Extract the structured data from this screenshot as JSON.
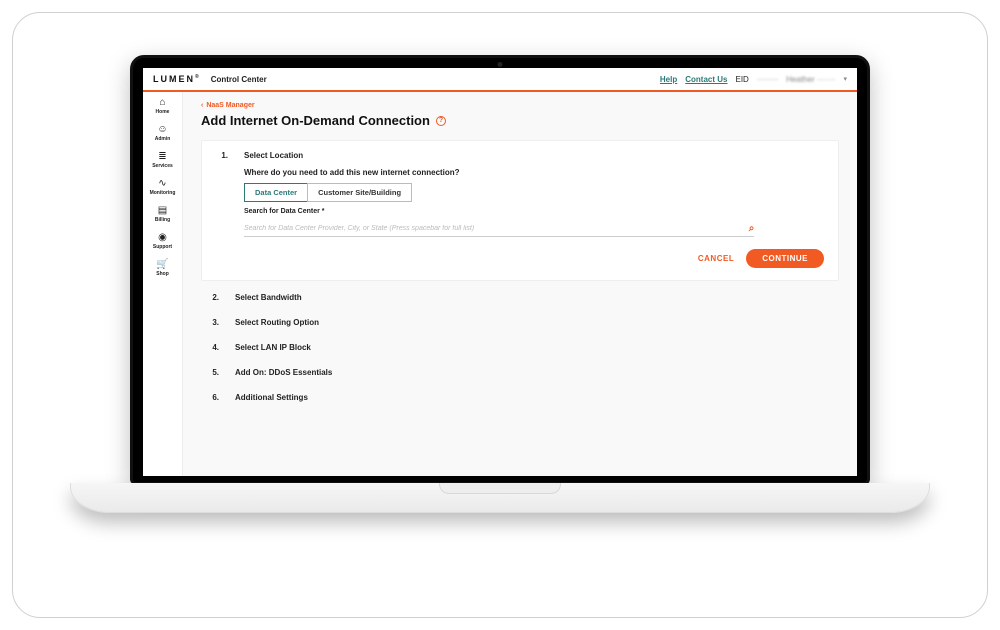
{
  "brand": "LUMEN",
  "app_name": "Control Center",
  "header": {
    "help": "Help",
    "contact": "Contact Us",
    "eid_label": "EID",
    "eid_value": "········",
    "username": "Heather ·······"
  },
  "sidebar": [
    {
      "icon": "⌂",
      "label": "Home",
      "name": "sidebar-item-home"
    },
    {
      "icon": "☺",
      "label": "Admin",
      "name": "sidebar-item-admin"
    },
    {
      "icon": "≣",
      "label": "Services",
      "name": "sidebar-item-services"
    },
    {
      "icon": "∿",
      "label": "Monitoring",
      "name": "sidebar-item-monitoring"
    },
    {
      "icon": "▤",
      "label": "Billing",
      "name": "sidebar-item-billing"
    },
    {
      "icon": "◉",
      "label": "Support",
      "name": "sidebar-item-support"
    },
    {
      "icon": "🛒",
      "label": "Shop",
      "name": "sidebar-item-shop"
    }
  ],
  "breadcrumb": "NaaS Manager",
  "page_title": "Add Internet On-Demand Connection",
  "steps": [
    {
      "num": "1.",
      "label": "Select Location"
    },
    {
      "num": "2.",
      "label": "Select Bandwidth"
    },
    {
      "num": "3.",
      "label": "Select Routing Option"
    },
    {
      "num": "4.",
      "label": "Select LAN IP Block"
    },
    {
      "num": "5.",
      "label": "Add On: DDoS Essentials"
    },
    {
      "num": "6.",
      "label": "Additional Settings"
    }
  ],
  "step1": {
    "question": "Where do you need to add this new internet connection?",
    "tab_data_center": "Data Center",
    "tab_customer_site": "Customer Site/Building",
    "search_label": "Search for Data Center *",
    "search_placeholder": "Search for Data Center Provider, City, or State (Press spacebar for full list)",
    "cancel": "CANCEL",
    "continue": "CONTINUE"
  }
}
